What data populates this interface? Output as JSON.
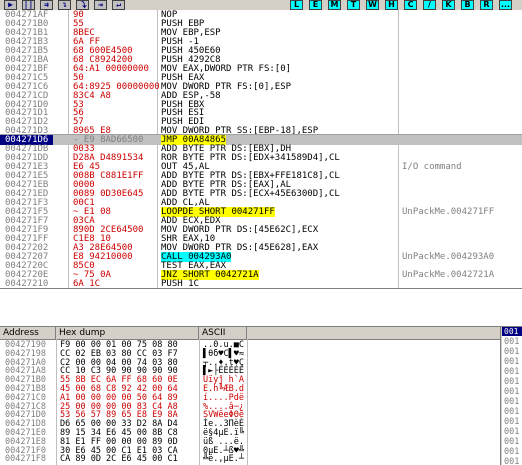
{
  "toolbar": {
    "playback_buttons": [
      "▶",
      "||",
      "⇉",
      "↴",
      "⤵",
      "⇥",
      "↵"
    ],
    "letter_buttons": [
      "L",
      "E",
      "M",
      "T",
      "W",
      "H",
      "C",
      "/",
      "K",
      "B",
      "R",
      "..."
    ]
  },
  "disassembly": {
    "rows": [
      {
        "addr": "004271AF",
        "hex": "90",
        "inst": "NOP",
        "comment": ""
      },
      {
        "addr": "004271B0",
        "hex": "55",
        "inst": "PUSH EBP",
        "comment": ""
      },
      {
        "addr": "004271B1",
        "hex": "8BEC",
        "inst": "MOV EBP,ESP",
        "comment": ""
      },
      {
        "addr": "004271B3",
        "hex": "6A FF",
        "inst": "PUSH -1",
        "comment": ""
      },
      {
        "addr": "004271B5",
        "hex": "68 600E4500",
        "inst": "PUSH 450E60",
        "comment": ""
      },
      {
        "addr": "004271BA",
        "hex": "68 C8924200",
        "inst": "PUSH 4292C8",
        "comment": ""
      },
      {
        "addr": "004271BF",
        "hex": "64:A1 00000000",
        "inst": "MOV EAX,DWORD PTR FS:[0]",
        "comment": ""
      },
      {
        "addr": "004271C5",
        "hex": "50",
        "inst": "PUSH EAX",
        "comment": ""
      },
      {
        "addr": "004271C6",
        "hex": "64:8925 00000000",
        "inst": "MOV DWORD PTR FS:[0],ESP",
        "comment": ""
      },
      {
        "addr": "004271CD",
        "hex": "83C4 A8",
        "inst": "ADD ESP,-58",
        "comment": ""
      },
      {
        "addr": "004271D0",
        "hex": "53",
        "inst": "PUSH EBX",
        "comment": ""
      },
      {
        "addr": "004271D1",
        "hex": "56",
        "inst": "PUSH ESI",
        "comment": ""
      },
      {
        "addr": "004271D2",
        "hex": "57",
        "inst": "PUSH EDI",
        "comment": ""
      },
      {
        "addr": "004271D3",
        "hex": "8965 E8",
        "inst": "MOV DWORD PTR SS:[EBP-18],ESP",
        "comment": ""
      },
      {
        "addr": "004271D6",
        "hex": "- E9 8AD66500",
        "inst": "JMP 00A84865",
        "comment": ""
      },
      {
        "addr": "004271DB",
        "hex": "0033",
        "inst": "ADD BYTE PTR DS:[EBX],DH",
        "comment": ""
      },
      {
        "addr": "004271DD",
        "hex": "D28A D4891534",
        "inst": "ROR BYTE PTR DS:[EDX+341589D4],CL",
        "comment": ""
      },
      {
        "addr": "004271E3",
        "hex": "E6 45",
        "inst": "OUT 45,AL",
        "comment": "I/O command"
      },
      {
        "addr": "004271E5",
        "hex": "008B C881E1FF",
        "inst": "ADD BYTE PTR DS:[EBX+FFE181C8],CL",
        "comment": ""
      },
      {
        "addr": "004271EB",
        "hex": "0000",
        "inst": "ADD BYTE PTR DS:[EAX],AL",
        "comment": ""
      },
      {
        "addr": "004271ED",
        "hex": "0089 0D30E645",
        "inst": "ADD BYTE PTR DS:[ECX+45E6300D],CL",
        "comment": ""
      },
      {
        "addr": "004271F3",
        "hex": "00C1",
        "inst": "ADD CL,AL",
        "comment": ""
      },
      {
        "addr": "004271F5",
        "hex": "~ E1 08",
        "inst": "LOOPDE SHORT 004271FF",
        "comment": "UnPackMe.004271FF"
      },
      {
        "addr": "004271F7",
        "hex": "03CA",
        "inst": "ADD ECX,EDX",
        "comment": ""
      },
      {
        "addr": "004271F9",
        "hex": "890D 2CE64500",
        "inst": "MOV DWORD PTR DS:[45E62C],ECX",
        "comment": ""
      },
      {
        "addr": "004271FF",
        "hex": "C1E8 10",
        "inst": "SHR EAX,10",
        "comment": ""
      },
      {
        "addr": "00427202",
        "hex": "A3 28E64500",
        "inst": "MOV DWORD PTR DS:[45E628],EAX",
        "comment": ""
      },
      {
        "addr": "00427207",
        "hex": "E8 94210000",
        "inst": "CALL 004293A0",
        "comment": "UnPackMe.004293A0"
      },
      {
        "addr": "0042720C",
        "hex": "85C0",
        "inst": "TEST EAX,EAX",
        "comment": ""
      },
      {
        "addr": "0042720E",
        "hex": "~ 75 0A",
        "inst": "JNZ SHORT 0042721A",
        "comment": "UnPackMe.0042721A"
      },
      {
        "addr": "00427210",
        "hex": "6A 1C",
        "inst": "PUSH 1C",
        "comment": ""
      }
    ]
  },
  "dump": {
    "headers": {
      "address": "Address",
      "hex": "Hex dump",
      "ascii": "ASCII"
    },
    "rows": [
      {
        "addr": "00427190",
        "hex": "F9 00 00 01 00 75 08 80",
        "ascii": "..0.u.■C",
        "red": false
      },
      {
        "addr": "00427198",
        "hex": "CC 02 EB 03 80 CC 03 F7",
        "ascii": "▌θδ♥C▌♥≈",
        "red": false
      },
      {
        "addr": "004271A0",
        "hex": "C2 00 00 04 00 74 03 80",
        "ascii": "┬..♦.t♥Ç",
        "red": false
      },
      {
        "addr": "004271A8",
        "hex": "CC 10 C3 90 90 90 90 90",
        "ascii": "▌►├ÉÉÉÉÉ",
        "red": false
      },
      {
        "addr": "004271B0",
        "hex": "55 8B EC 6A FF 68 60 0E",
        "ascii": "Uïyĵ h`A",
        "red": true
      },
      {
        "addr": "004271B8",
        "hex": "45 00 68 C8 92 42 00 64",
        "ascii": "E.h╚ÆB.d",
        "red": true
      },
      {
        "addr": "004271C0",
        "hex": "A1 00 00 00 00 50 64 89",
        "ascii": "í....Pdë",
        "red": true
      },
      {
        "addr": "004271C8",
        "hex": "25 00 00 00 00 83 C4 A8",
        "ascii": "%....â─¿",
        "red": true
      },
      {
        "addr": "004271D0",
        "hex": "53 56 57 89 65 E8 E9 8A",
        "ascii": "SVWëeΦΘè",
        "red": true
      },
      {
        "addr": "004271D8",
        "hex": "D6 65 00 00 33 D2 8A D4",
        "ascii": "Íe..3ΠèÈ",
        "red": false
      },
      {
        "addr": "004271E0",
        "hex": "89 15 34 E6 45 00 8B C8",
        "ascii": "ë§4µE.ï╚",
        "red": false
      },
      {
        "addr": "004271E8",
        "hex": "81 E1 FF 00 00 00 89 0D",
        "ascii": "üß ...ë.",
        "red": false
      },
      {
        "addr": "004271F0",
        "hex": "30 E6 45 00 C1 E1 03 CA",
        "ascii": "0µE.┴ß♥╩",
        "red": false
      },
      {
        "addr": "004271F8",
        "hex": "CA 89 0D 2C E6 45 00 C1",
        "ascii": "╩ë.,µE.┴",
        "red": false
      }
    ]
  },
  "stack": {
    "top": "001",
    "rows": [
      "001",
      "001",
      "001",
      "001",
      "001",
      "001",
      "001",
      "001",
      "001",
      "001",
      "001",
      "001",
      "001"
    ]
  }
}
